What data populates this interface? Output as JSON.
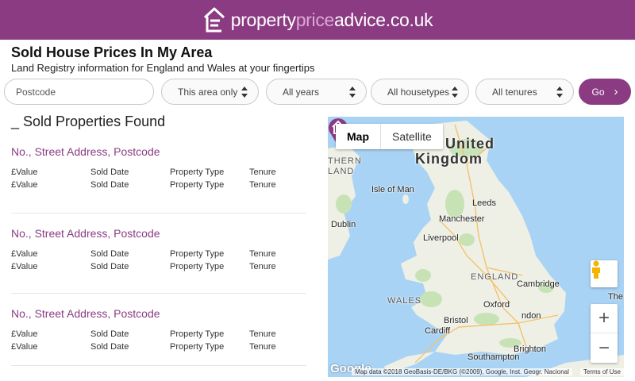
{
  "header": {
    "logo_text_1": "property",
    "logo_text_2": "price",
    "logo_text_3": "advice.co.uk",
    "brand_color": "#8a3b82"
  },
  "page": {
    "title": "Sold House Prices In My Area",
    "subtitle": "Land Registry information for England and Wales at your fingertips"
  },
  "filters": {
    "postcode_placeholder": "Postcode",
    "area": "This area only",
    "years": "All years",
    "housetypes": "All housetypes",
    "tenures": "All tenures",
    "go_label": "Go"
  },
  "results": {
    "count_label": "_ Sold Properties Found",
    "items": [
      {
        "title": "No., Street Address, Postcode",
        "rows": [
          [
            "£Value",
            "Sold Date",
            "Property Type",
            "Tenure"
          ],
          [
            "£Value",
            "Sold Date",
            "Property Type",
            "Tenure"
          ]
        ]
      },
      {
        "title": "No., Street Address, Postcode",
        "rows": [
          [
            "£Value",
            "Sold Date",
            "Property Type",
            "Tenure"
          ],
          [
            "£Value",
            "Sold Date",
            "Property Type",
            "Tenure"
          ]
        ]
      },
      {
        "title": "No., Street Address, Postcode",
        "rows": [
          [
            "£Value",
            "Sold Date",
            "Property Type",
            "Tenure"
          ],
          [
            "£Value",
            "Sold Date",
            "Property Type",
            "Tenure"
          ]
        ]
      }
    ]
  },
  "map": {
    "type_map": "Map",
    "type_satellite": "Satellite",
    "attribution": "Map data ©2018 GeoBasis-DE/BKG (©2009), Google, Inst. Geogr. Nacional",
    "terms": "Terms of Use",
    "google": "Google",
    "labels": {
      "country_1": "United",
      "country_2": "Kingdom",
      "ireland_1": "THERN",
      "ireland_2": "LAND",
      "isle_of_man": "Isle of Man",
      "leeds": "Leeds",
      "manchester": "Manchester",
      "dublin": "Dublin",
      "liverpool": "Liverpool",
      "england": "ENGLAND",
      "cambridge": "Cambridge",
      "wales": "WALES",
      "oxford": "Oxford",
      "london": "ndon",
      "bristol": "Bristol",
      "cardiff": "Cardiff",
      "brighton": "Brighton",
      "southampton": "Southampton",
      "the": "The"
    }
  }
}
